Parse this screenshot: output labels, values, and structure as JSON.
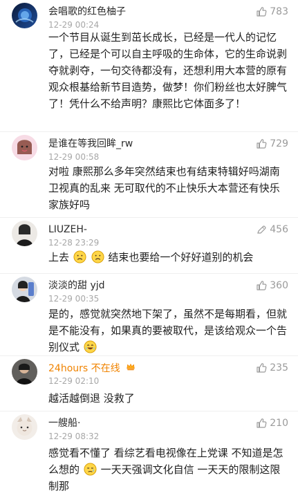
{
  "comments": [
    {
      "username": "会唱歌的红色柚子",
      "time": "12-29 00:24",
      "likes": "783",
      "text": "一个节目从诞生到茁长成长，已经是一代人的记忆了，已经是个可以自主呼吸的生命体，它的生命说剥夺就剥夺，一句交待都没有，还想利用大本营的原有观众根基给新节目造势，做梦！你们粉丝也太好脾气了！凭什么不给声明？康熙比它体面多了！"
    },
    {
      "username": "是谁在等我回眸_rw",
      "time": "12-29 00:58",
      "likes": "729",
      "text": "对啦 康熙那么多年突然结束也有结束特辑好吗湖南卫视真的乱来 无可取代的不止快乐大本营还有快乐家族好吗"
    },
    {
      "username": "LIUZEH-",
      "time": "12-28 23:29",
      "likes": "456",
      "text_prefix": "上去",
      "text_suffix": "结束也要给一个好好道别的机会"
    },
    {
      "username": "淡淡的甜 yjd",
      "time": "12-29 00:35",
      "likes": "360",
      "text": "是的，感觉就突然地下架了，虽然不是每期看，但就是不能没有，如果真的要被取代，是该给观众一个告别仪式"
    },
    {
      "username": "24hours 不在线",
      "time": "12-29 02:10",
      "likes": "235",
      "text": "越活越倒退 没救了"
    },
    {
      "username": "一艘船·",
      "time": "12-29 08:32",
      "likes": "210",
      "text_prefix": "感觉看不懂了 看综艺看电视像在上党课 不知道是怎么想的",
      "text_suffix": "一天天强调文化自信 一天天的限制这限制那"
    }
  ],
  "icons": {
    "like": "thumbs-up-icon",
    "vip": "crown-badge-icon",
    "emoji_frown": "frowning-face-emoji-icon",
    "emoji_laugh": "laughing-tears-emoji-icon",
    "emoji_sad": "sad-face-emoji-icon"
  },
  "colors": {
    "text": "#1f1f1f",
    "meta": "#a7a7a7",
    "like": "#9a9a9a",
    "vip_name": "#f08300"
  }
}
